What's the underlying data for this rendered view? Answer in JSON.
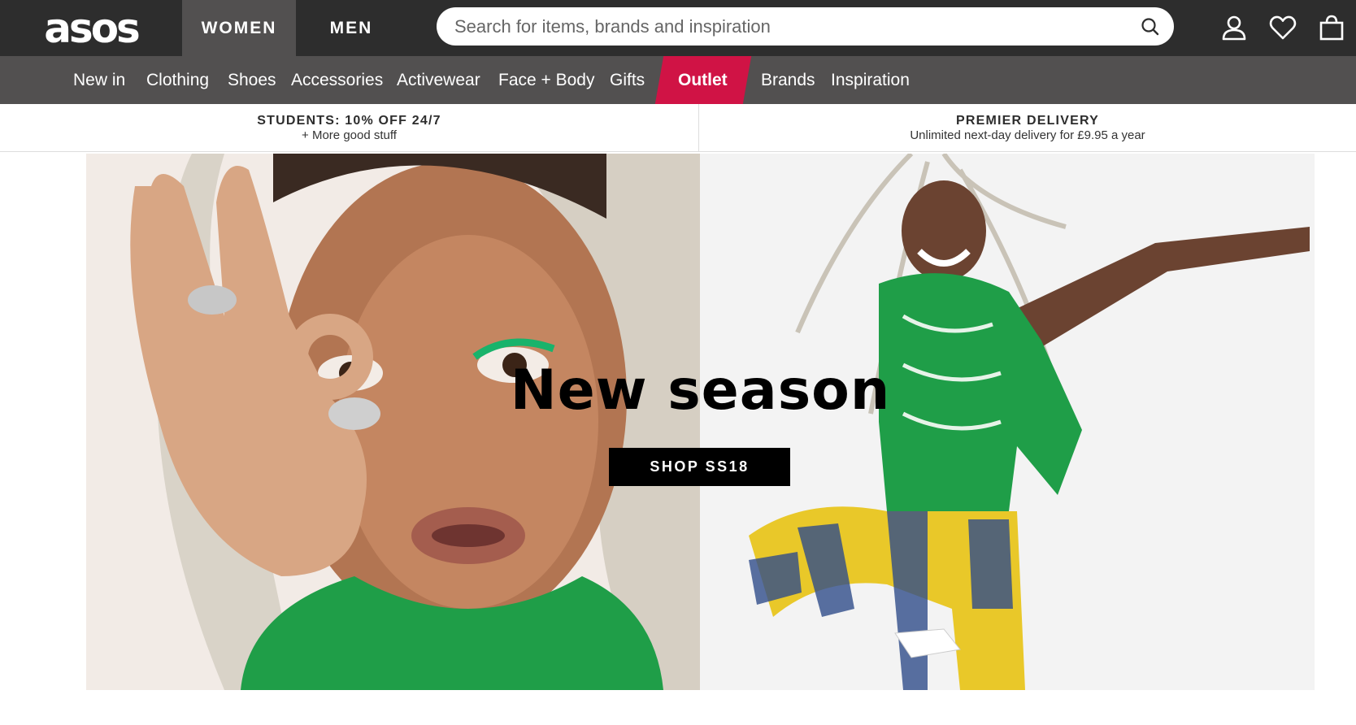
{
  "header": {
    "logo": "asos",
    "gender_tabs": [
      "WOMEN",
      "MEN"
    ],
    "active_gender": "WOMEN",
    "search": {
      "placeholder": "Search for items, brands and inspiration",
      "value": ""
    },
    "icons": [
      "account-icon",
      "heart-icon",
      "bag-icon"
    ]
  },
  "nav": {
    "items": [
      "New in",
      "Clothing",
      "Shoes",
      "Accessories",
      "Activewear",
      "Face + Body",
      "Gifts",
      "Outlet",
      "Brands",
      "Inspiration"
    ],
    "highlight_item": "Outlet"
  },
  "promos": [
    {
      "title": "STUDENTS: 10% OFF 24/7",
      "subtitle": "+ More good stuff"
    },
    {
      "title": "PREMIER DELIVERY",
      "subtitle": "Unlimited next-day delivery for £9.95 a year"
    }
  ],
  "hero": {
    "title": "New season",
    "cta": "SHOP SS18"
  },
  "colors": {
    "topbar": "#2d2d2d",
    "nav": "#525050",
    "outlet_accent": "#d01345",
    "hero_button": "#000000"
  }
}
